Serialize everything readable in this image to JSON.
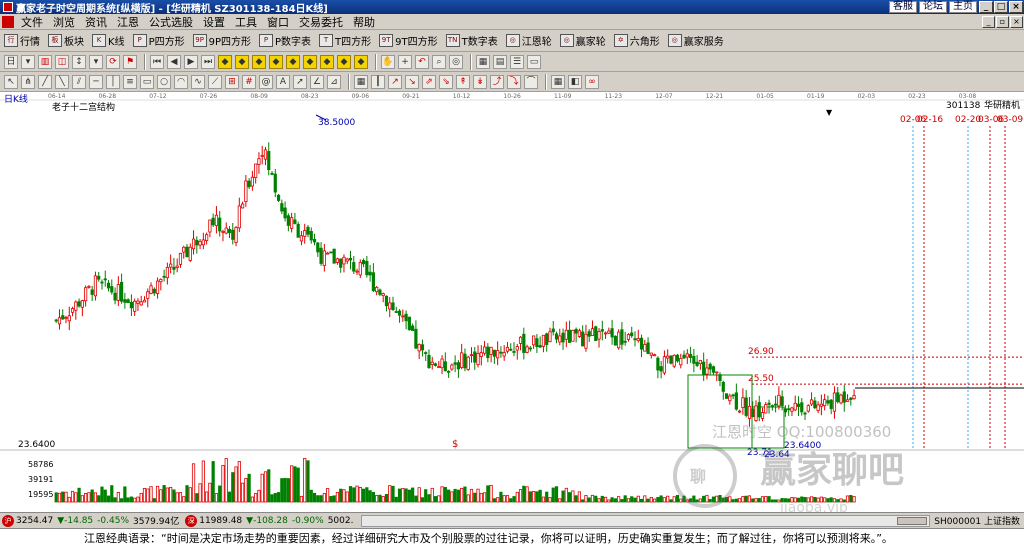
{
  "window": {
    "title": "赢家老子时空周期系统[纵横版] - [华研精机  SZ301138-184日K线]",
    "links": [
      "客服",
      "论坛",
      "主页"
    ]
  },
  "menu": {
    "items": [
      "文件",
      "浏览",
      "资讯",
      "江恩",
      "公式选股",
      "设置",
      "工具",
      "窗口",
      "交易委托",
      "帮助"
    ]
  },
  "toolbar": {
    "items": [
      {
        "icon": "行",
        "label": "行情"
      },
      {
        "icon": "板",
        "label": "板块"
      },
      {
        "icon": "K",
        "label": "K线"
      },
      {
        "icon": "P",
        "label": "P四方形"
      },
      {
        "icon": "9P",
        "label": "9P四方形"
      },
      {
        "icon": "P",
        "label": "P数字表"
      },
      {
        "icon": "T",
        "label": "T四方形"
      },
      {
        "icon": "9T",
        "label": "9T四方形"
      },
      {
        "icon": "TN",
        "label": "T数字表"
      },
      {
        "icon": "◎",
        "label": "江恩轮"
      },
      {
        "icon": "◎",
        "label": "赢家轮"
      },
      {
        "icon": "✡",
        "label": "六角形"
      },
      {
        "icon": "◎",
        "label": "赢家服务"
      }
    ]
  },
  "chart_header": {
    "period": "日K线",
    "pattern": "老子十二宫结构",
    "stock_code": "301138",
    "stock_name": "华研精机",
    "date_ticks": [
      "06-14",
      "06-28",
      "07-12",
      "07-26",
      "08-09",
      "08-23",
      "09-06",
      "09-21",
      "10-12",
      "10-26",
      "11-09",
      "11-23",
      "12-07",
      "12-21",
      "01-05",
      "01-19",
      "02-03",
      "02-23",
      "03-08"
    ]
  },
  "price_labels": {
    "high": "38.5000",
    "low": "23.6400",
    "low_short": "23.64",
    "bottom": "23.71",
    "axis_low": "23.6400",
    "level1": "26.90",
    "level2": "25.50"
  },
  "future_dates": [
    "02-06",
    "02-16",
    "02-20",
    "03-06",
    "03-09"
  ],
  "volume_ticks": [
    "58786",
    "39191",
    "19595"
  ],
  "watermark": {
    "qq": "江恩时空 QQ:100800360",
    "brand": "赢家聊吧",
    "url": "jiaoba.vip"
  },
  "status": {
    "sh_index": "3254.47",
    "sh_change": "▼-14.85",
    "sh_pct": "-0.45%",
    "sh_amount": "3579.94亿",
    "sz_index": "11989.48",
    "sz_change": "▼-108.28",
    "sz_pct": "-0.90%",
    "sz_amount": "5002.",
    "index_code": "SH000001 上证指数"
  },
  "quote": "江恩经典语录：“时间是决定市场走势的重要因素，经过详细研究大市及个别股票的过往记录，你将可以证明，历史确实重复发生；而了解过往，你将可以预测将来。”。",
  "chart_data": {
    "type": "candlestick",
    "symbol": "301138",
    "name": "华研精机",
    "period": "daily",
    "ylim": [
      22.5,
      39.5
    ],
    "colors": {
      "up": "#e00000",
      "down": "#008000"
    },
    "close_trend": [
      [
        0,
        28.8
      ],
      [
        6,
        29.6
      ],
      [
        12,
        30.7
      ],
      [
        18,
        30.3
      ],
      [
        24,
        29.8
      ],
      [
        30,
        30.6
      ],
      [
        36,
        31.5
      ],
      [
        42,
        32.8
      ],
      [
        48,
        34.0
      ],
      [
        54,
        33.1
      ],
      [
        58,
        35.6
      ],
      [
        63,
        37.8
      ],
      [
        66,
        36.2
      ],
      [
        70,
        34.1
      ],
      [
        76,
        33.2
      ],
      [
        82,
        32.0
      ],
      [
        88,
        31.9
      ],
      [
        94,
        31.3
      ],
      [
        100,
        30.2
      ],
      [
        106,
        28.7
      ],
      [
        112,
        27.0
      ],
      [
        118,
        26.4
      ],
      [
        124,
        26.7
      ],
      [
        130,
        27.1
      ],
      [
        136,
        27.3
      ],
      [
        142,
        27.5
      ],
      [
        148,
        27.7
      ],
      [
        154,
        27.9
      ],
      [
        160,
        27.9
      ],
      [
        166,
        28.0
      ],
      [
        172,
        27.8
      ],
      [
        178,
        27.6
      ],
      [
        184,
        26.4
      ],
      [
        190,
        26.7
      ],
      [
        196,
        26.6
      ],
      [
        202,
        25.8
      ],
      [
        208,
        24.6
      ],
      [
        214,
        24.0
      ],
      [
        220,
        24.5
      ],
      [
        226,
        24.4
      ],
      [
        232,
        24.3
      ],
      [
        238,
        24.6
      ],
      [
        244,
        25.2
      ]
    ],
    "annotations": {
      "high": 38.5,
      "low": 23.64,
      "resistance": [
        26.9,
        25.5
      ]
    }
  }
}
